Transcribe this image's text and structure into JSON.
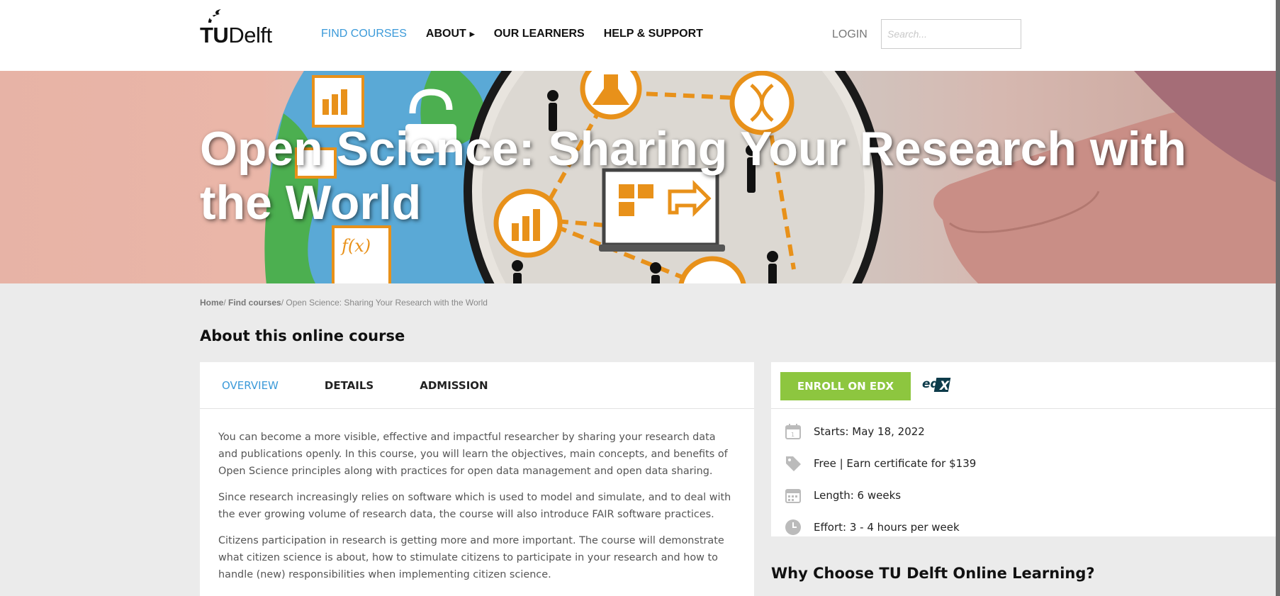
{
  "header": {
    "logo_text_bold": "TU",
    "logo_text": "Delft",
    "nav": [
      {
        "label": "FIND COURSES"
      },
      {
        "label": "ABOUT"
      },
      {
        "label": "OUR LEARNERS"
      },
      {
        "label": "HELP & SUPPORT"
      }
    ],
    "login_label": "LOGIN",
    "search_placeholder": "Search..."
  },
  "hero": {
    "title": "Open Science: Sharing Your Research with the World"
  },
  "breadcrumb": {
    "home": "Home",
    "find_courses": "Find courses",
    "current": "Open Science: Sharing Your Research with the World"
  },
  "about": {
    "title": "About this online course",
    "tabs": [
      {
        "label": "OVERVIEW"
      },
      {
        "label": "DETAILS"
      },
      {
        "label": "ADMISSION"
      }
    ],
    "paragraphs": [
      "You can become a more visible, effective and impactful researcher by sharing your research data and publications openly. In this course, you will learn the objectives, main concepts, and benefits of Open Science principles along with practices for open data management and open data sharing.",
      "Since research increasingly relies on software which is used to model and simulate, and to deal with the ever growing volume of research data, the course will also introduce FAIR software practices.",
      "Citizens participation in research is getting more and more important. The course will demonstrate what citizen science is about, how to stimulate citizens to participate in your research and how to handle (new) responsibilities when implementing citizen science."
    ]
  },
  "side": {
    "enroll_label": "ENROLL ON EDX",
    "edx_logo_text": "edX",
    "info": [
      {
        "icon": "calendar-icon",
        "text": "Starts: May 18, 2022"
      },
      {
        "icon": "price-tag-icon",
        "text": "Free | Earn certificate for $139"
      },
      {
        "icon": "calendar-grid-icon",
        "text": "Length: 6 weeks"
      },
      {
        "icon": "clock-icon",
        "text": "Effort: 3 - 4 hours per week"
      }
    ],
    "why_title": "Why Choose TU Delft Online Learning?"
  },
  "colors": {
    "accent_blue": "#3b9ad9",
    "enroll_green": "#8dc63f",
    "page_bg": "#ebebeb"
  }
}
